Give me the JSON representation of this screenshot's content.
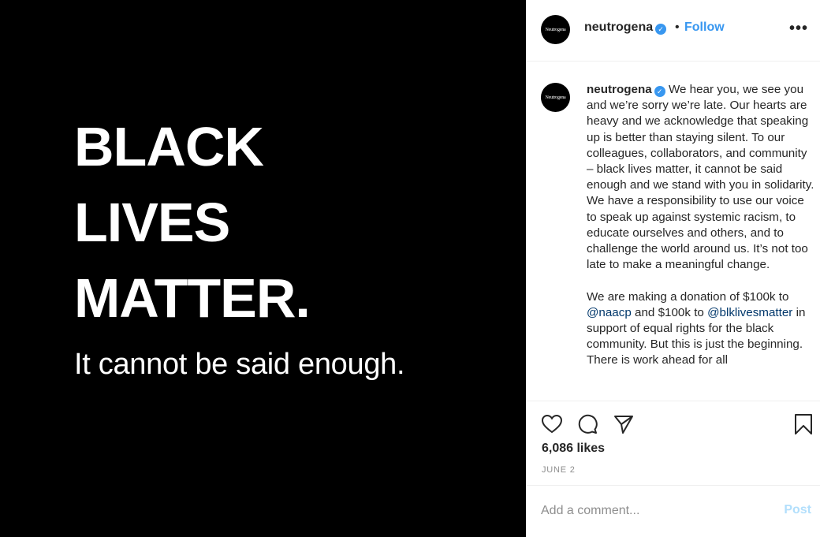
{
  "post_image": {
    "headline_lines": [
      "BLACK",
      "LIVES",
      "MATTER."
    ],
    "subline": "It cannot be said enough."
  },
  "header": {
    "avatar_text": "Neutrogena",
    "username": "neutrogena",
    "separator": "•",
    "follow_label": "Follow",
    "more_label": "•••"
  },
  "caption": {
    "avatar_text": "Neutrogena",
    "username": "neutrogena",
    "paragraph1": "We hear you, we see you and we’re sorry we’re late. Our hearts are heavy and we acknowledge that speaking up is better than staying silent. To our colleagues, collaborators, and community – black lives matter, it cannot be said enough and we stand with you in solidarity. We have a responsibility to use our voice to speak up against systemic racism, to educate ourselves and others, and to challenge the world around us. It’s not too late to make a meaningful change.",
    "p2_part1": "We are making a donation of $100k to ",
    "mention1": "@naacp",
    "p2_part2": " and $100k to ",
    "mention2": "@blklivesmatter",
    "p2_part3": " in support of equal rights for the black community. But this is just the beginning. There is work ahead for all"
  },
  "actions": {
    "likes": "6,086 likes",
    "date": "JUNE 2"
  },
  "comment": {
    "placeholder": "Add a comment...",
    "post_label": "Post"
  },
  "colors": {
    "image_bg": "#000000",
    "accent_blue": "#3897f0",
    "mention_blue": "#00376b",
    "post_disabled": "#b2dffc",
    "muted": "#8e8e8e"
  }
}
